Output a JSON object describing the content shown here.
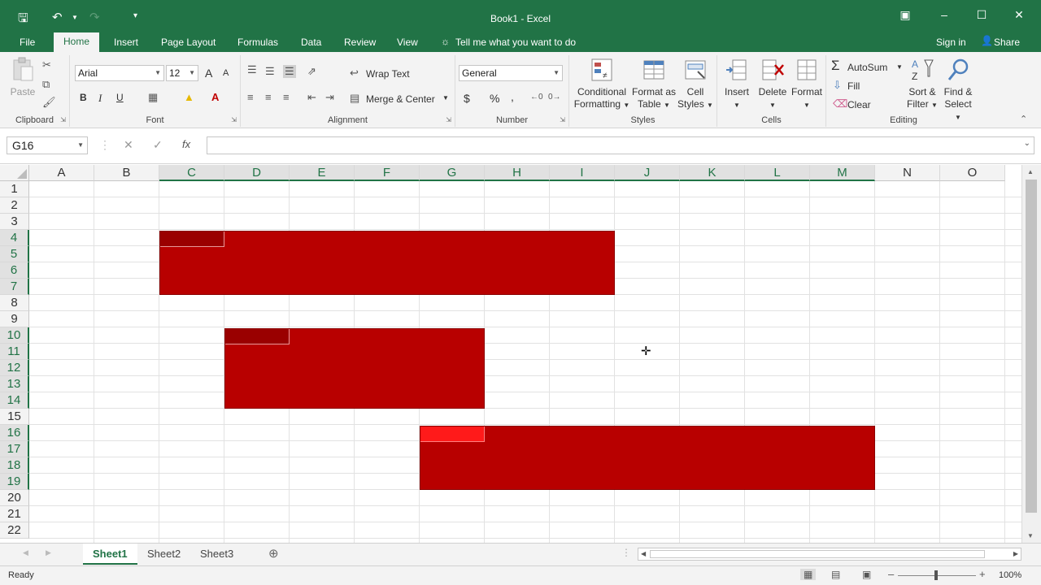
{
  "window": {
    "title": "Book1 - Excel"
  },
  "qat": {
    "save_icon": "save-icon",
    "undo_icon": "undo-icon",
    "redo_icon": "redo-icon",
    "customize_icon": "customize-qat-icon"
  },
  "tabs": [
    "File",
    "Home",
    "Insert",
    "Page Layout",
    "Formulas",
    "Data",
    "Review",
    "View"
  ],
  "tell_me": "Tell me what you want to do",
  "sign_in": "Sign in",
  "share": "Share",
  "ribbon": {
    "clipboard": {
      "label": "Clipboard",
      "paste": "Paste"
    },
    "font": {
      "label": "Font",
      "name": "Arial",
      "size": "12",
      "bold": "B",
      "italic": "I",
      "underline": "U",
      "grow": "A",
      "shrink": "A"
    },
    "alignment": {
      "label": "Alignment",
      "wrap": "Wrap Text",
      "merge": "Merge & Center"
    },
    "number": {
      "label": "Number",
      "format": "General",
      "currency": "$",
      "percent": "%",
      "comma": ","
    },
    "styles": {
      "label": "Styles",
      "cond1": "Conditional",
      "cond2": "Formatting",
      "fmt1": "Format as",
      "fmt2": "Table",
      "cell1": "Cell",
      "cell2": "Styles"
    },
    "cells": {
      "label": "Cells",
      "insert": "Insert",
      "delete": "Delete",
      "format": "Format"
    },
    "editing": {
      "label": "Editing",
      "autosum": "AutoSum",
      "fill": "Fill",
      "clear": "Clear",
      "sort1": "Sort &",
      "sort2": "Filter",
      "find1": "Find &",
      "find2": "Select"
    }
  },
  "formula_bar": {
    "name_box": "G16",
    "cancel": "✕",
    "enter": "✓",
    "fx": "fx",
    "value": ""
  },
  "columns": [
    "A",
    "B",
    "C",
    "D",
    "E",
    "F",
    "G",
    "H",
    "I",
    "J",
    "K",
    "L",
    "M",
    "N",
    "O"
  ],
  "rows": [
    "1",
    "2",
    "3",
    "4",
    "5",
    "6",
    "7",
    "8",
    "9",
    "10",
    "11",
    "12",
    "13",
    "14",
    "15",
    "16",
    "17",
    "18",
    "19",
    "20",
    "21",
    "22"
  ],
  "sheets": [
    "Sheet1",
    "Sheet2",
    "Sheet3"
  ],
  "status": {
    "ready": "Ready",
    "zoom": "100%"
  },
  "colors": {
    "accent": "#217346",
    "shape": "#b80000"
  }
}
